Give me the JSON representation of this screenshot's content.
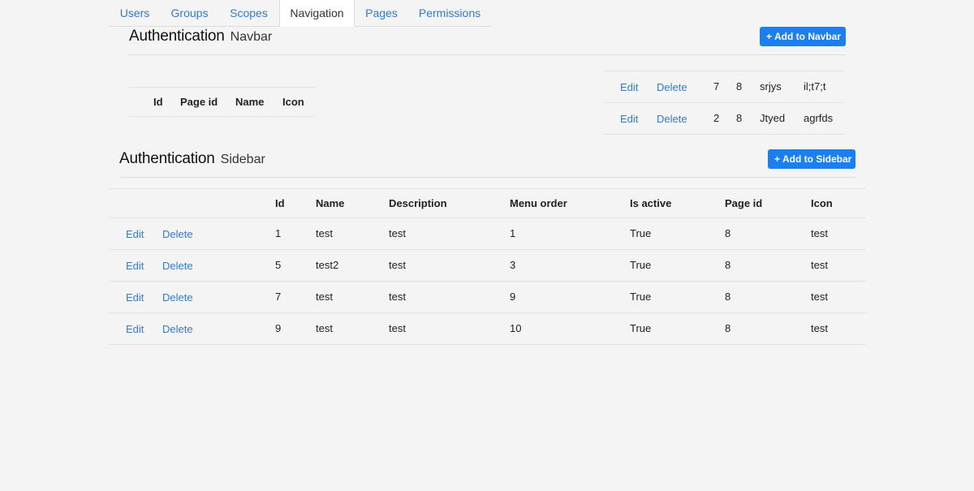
{
  "tabs": [
    {
      "label": "Users",
      "active": false
    },
    {
      "label": "Groups",
      "active": false
    },
    {
      "label": "Scopes",
      "active": false
    },
    {
      "label": "Navigation",
      "active": true
    },
    {
      "label": "Pages",
      "active": false
    },
    {
      "label": "Permissions",
      "active": false
    }
  ],
  "navbar": {
    "title": "Authentication",
    "subtitle": "Navbar",
    "add_button": "Add to Navbar",
    "columns": [
      "Id",
      "Page id",
      "Name",
      "Icon"
    ],
    "rows": [
      {
        "edit": "Edit",
        "delete": "Delete",
        "id": "7",
        "page_id": "8",
        "name": "srjys",
        "icon": "il;t7;t"
      },
      {
        "edit": "Edit",
        "delete": "Delete",
        "id": "2",
        "page_id": "8",
        "name": "Jtyed",
        "icon": "agrfds"
      }
    ]
  },
  "sidebar": {
    "title": "Authentication",
    "subtitle": "Sidebar",
    "add_button": "Add to Sidebar",
    "columns": [
      "Id",
      "Name",
      "Description",
      "Menu order",
      "Is active",
      "Page id",
      "Icon"
    ],
    "rows": [
      {
        "edit": "Edit",
        "delete": "Delete",
        "id": "1",
        "name": "test",
        "description": "test",
        "menu_order": "1",
        "is_active": "True",
        "page_id": "8",
        "icon": "test"
      },
      {
        "edit": "Edit",
        "delete": "Delete",
        "id": "5",
        "name": "test2",
        "description": "test",
        "menu_order": "3",
        "is_active": "True",
        "page_id": "8",
        "icon": "test"
      },
      {
        "edit": "Edit",
        "delete": "Delete",
        "id": "7",
        "name": "test",
        "description": "test",
        "menu_order": "9",
        "is_active": "True",
        "page_id": "8",
        "icon": "test"
      },
      {
        "edit": "Edit",
        "delete": "Delete",
        "id": "9",
        "name": "test",
        "description": "test",
        "menu_order": "10",
        "is_active": "True",
        "page_id": "8",
        "icon": "test"
      }
    ]
  },
  "colors": {
    "accent": "#1a7ff0",
    "link": "#2f7bd6",
    "background": "#f4f4f4"
  }
}
